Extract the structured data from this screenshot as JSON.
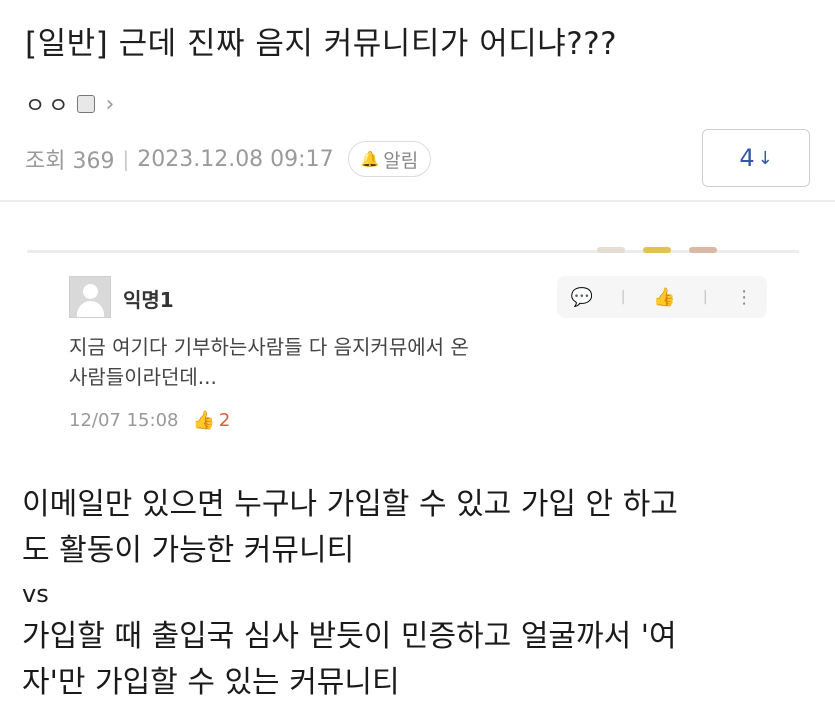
{
  "post": {
    "title": "[일반] 근데 진짜 음지 커뮤니티가 어디냐???",
    "author_name": "ㅇㅇ",
    "author_chevron": "›",
    "views": "조회 369",
    "separator": "|",
    "datetime": "2023.12.08 09:17",
    "alarm_label": "알림",
    "alarm_icon": "bell-icon",
    "comment_count": "4",
    "comment_count_arrow": "↓"
  },
  "embedded_comment": {
    "author": "익명1",
    "text_lines": [
      "지금 여기다 기부하는사람들 다 음지커뮤에서 온",
      "사람들이라던데..."
    ],
    "timestamp": "12/07 15:08",
    "likes": "2",
    "actions": {
      "comment_icon": "💬",
      "like_icon": "👍",
      "more_icon": "⋮",
      "divider": "|"
    }
  },
  "body": {
    "lines": [
      "이메일만 있으면 누구나 가입할 수 있고 가입 안 하고",
      "도 활동이 가능한 커뮤니티",
      "vs",
      "가입할 때 출입국 심사 받듯이 민증하고 얼굴까서 '여",
      "자'만 가입할 수 있는 커뮤니티"
    ]
  },
  "colors": {
    "accent_blue": "#3457a8",
    "like_orange": "#d4603a",
    "meta_gray": "#9a9a9a"
  }
}
